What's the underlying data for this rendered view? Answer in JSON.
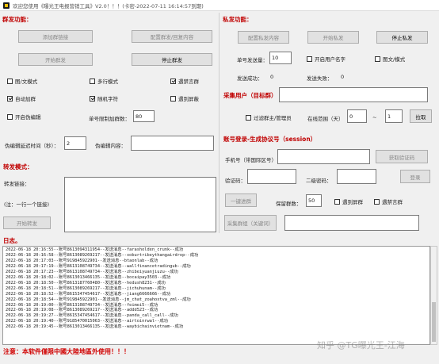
{
  "window": {
    "title": "欢迎您使用《曝光王电报营销工具》V2.0！！！(卡密-2022-07-11 16:14:57到期)"
  },
  "group": {
    "heading": "群发功能：",
    "add_link_btn": "添加群链接",
    "config_btn": "配置群发/回复内容",
    "start_btn": "开始群发",
    "stop_btn": "停止群发",
    "opt_image_text": "图/文模式",
    "opt_multiline": "多行模式",
    "opt_skip_muted": "遇禁言群",
    "opt_auto_join": "自动加群",
    "opt_random_char": "随机字符",
    "opt_auto_block": "遇到屏蔽",
    "opt_fake_edit": "开启伪编辑",
    "limit_label": "单号限制加群数：",
    "limit_value": "80",
    "fake_delay_label": "伪编辑延迟时间（秒）：",
    "fake_delay_value": "2",
    "fake_content_label": "伪编辑内容：",
    "fake_content_value": ""
  },
  "forward": {
    "heading": "转发模式：",
    "link_label": "转发链接：",
    "note": "(注：一行一个链接)",
    "start_btn": "开始转发",
    "links_value": ""
  },
  "private": {
    "heading": "私发功能：",
    "config_btn": "配置私发内容",
    "start_btn": "开始私发",
    "stop_btn": "停止私发",
    "send_count_label": "单号发送量：",
    "send_count_value": "10",
    "opt_username": "开启用户名字",
    "opt_image_text": "图文/模式",
    "success_label": "发送成功：",
    "success_value": "0",
    "fail_label": "发送失败：",
    "fail_value": "0"
  },
  "collect": {
    "heading": "采集用户（目标群）",
    "target_value": "",
    "opt_filter_admin": "过滤群主/管理员",
    "online_label": "在线范围（天）",
    "range_from": "0",
    "range_sep": "~",
    "range_to": "1",
    "pull_btn": "拉取"
  },
  "account": {
    "heading": "账号登录-生成协议号（session）",
    "phone_label": "手机号（带国际区号）",
    "phone_value": "",
    "get_code_btn": "获取验证码",
    "code_label": "验证码：",
    "code_value": "",
    "pwd2_label": "二级密码：",
    "pwd2_value": "",
    "login_btn": "登录",
    "one_click_btn": "一键进群",
    "keep_label": "保留群数：",
    "keep_value": "50",
    "opt_block_group": "遇到屏群",
    "opt_mute_group": "遇禁言群",
    "collect_kw_btn": "采集群组（关键词）",
    "kw_value": ""
  },
  "log": {
    "heading": "日志。",
    "lines": [
      "2022-06-18 20:16:55--账号8613094311954--发送消息--farasholden_crunk--成功",
      "2022-06-18 20:16:58--账号8613089269217--发送消息--xoburtribeythangairdrop--成功",
      "2022-06-18 20:17:03--账号919845922901--发送消息--btaonlab--成功",
      "2022-06-18 20:17:19--账号8613108749734--发送消息--wallfinancetradingub--成功",
      "2022-06-18 20:17:23--账号8613108749734--发送消息--zhibeiyuanjiuzu--成功",
      "2022-06-18 20:18:02--账号8613013466135--发送消息--bocaipay3503--成功",
      "2022-06-18 20:18:50--账号8613187760480--发送消息--hedush8231--成功",
      "2022-06-18 20:18:51--账号8613089269217--发送消息--jichuhunam--成功",
      "2022-06-18 20:18:52--账号8615347454617--发送消息--jiang6666666--成功",
      "2022-06-18 20:18:54--账号919845922901--发送消息--jm_chat_zoahoxtva_zml--成功",
      "2022-06-18 20:19:00--账号8613108749734--发送消息--feimei5--成功",
      "2022-06-18 20:19:08--账号8613089269217--发送消息--addd523--成功",
      "2022-06-18 20:19:27--账号8615347454617--发送消息--panda_call_call--成功",
      "2022-06-18 20:19:40--账号9185470015063--发送消息--airtoinrwal--成功",
      "2022-06-18 20:19:45--账号8613013466135--发送消息--waybichainvietnam--成功"
    ]
  },
  "footer": {
    "notice": "注意：本软件僅限中國大陸地區外使用！！！"
  },
  "watermark": {
    "text": "知乎 @TG曝光王-江海"
  },
  "colors": {
    "heading_red": "#c00000",
    "footer_red": "#d00000"
  }
}
